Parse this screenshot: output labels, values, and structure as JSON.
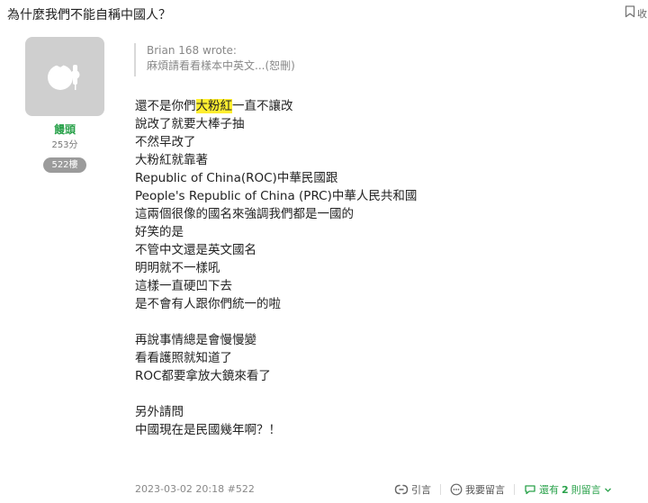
{
  "header": {
    "title": "為什麼我們不能自稱中國人？",
    "bookmark_label": "收"
  },
  "author": {
    "name": "饅頭",
    "points": "253分",
    "floor": "522樓"
  },
  "quote": {
    "author_line": "Brian 168 wrote:",
    "excerpt": "麻煩請看看樣本中英文...(恕刪)"
  },
  "post": {
    "line1_pre": "還不是你們",
    "line1_highlight": "大粉紅",
    "line1_post": "一直不讓改",
    "lines_a": [
      "說改了就要大棒子抽",
      "不然早改了",
      "大粉紅就靠著",
      "Republic of China(ROC)中華民國跟",
      "People's Republic of China (PRC)中華人民共和國",
      "這兩個很像的國名來強調我們都是一國的",
      "好笑的是",
      "不管中文還是英文國名",
      "明明就不一樣吼",
      "這樣一直硬凹下去",
      "是不會有人跟你們統一的啦"
    ],
    "lines_b": [
      "再說事情總是會慢慢變",
      "看看護照就知道了",
      "ROC都要拿放大鏡來看了"
    ],
    "lines_c": [
      "另外請問",
      "中國現在是民國幾年啊？！"
    ]
  },
  "footer": {
    "timestamp": "2023-03-02 20:18 #522",
    "quote_label": "引言",
    "reply_label": "我要留言",
    "more_pre": "還有",
    "more_count": "2",
    "more_post": "則留言"
  },
  "colors": {
    "accent_green": "#2aa24b",
    "highlight_yellow": "#ffee30",
    "floor_badge": "#9b9b9b"
  }
}
